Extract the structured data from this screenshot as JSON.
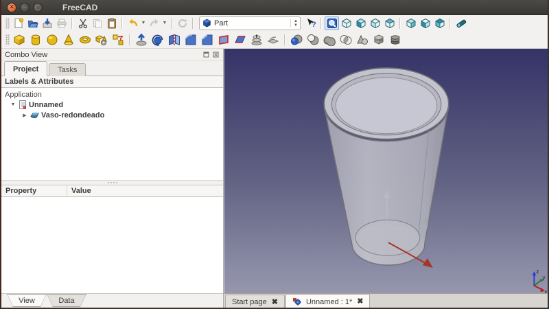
{
  "window": {
    "title": "FreeCAD",
    "controls": [
      "close",
      "minimize",
      "maximize"
    ]
  },
  "toolbars": {
    "row1_icons": [
      "new-file",
      "open-file",
      "save-file",
      "print",
      "cut",
      "copy",
      "paste",
      "undo",
      "undo-dropdown",
      "redo",
      "redo-dropdown",
      "refresh",
      "workbench-selector",
      "whats-this",
      "fit-all",
      "draw-style-cube",
      "axonometric-view",
      "front-view",
      "top-view",
      "rear-view",
      "left-view",
      "right-view",
      "measure-distance"
    ],
    "row2_icons": [
      "box-primitive",
      "cylinder-primitive",
      "sphere-primitive",
      "cone-primitive",
      "torus-primitive",
      "create-primitives",
      "shape-builder",
      "extrude",
      "revolve",
      "mirror",
      "fillet",
      "chamfer",
      "ruled-surface",
      "loft",
      "sweep",
      "boolean-operation",
      "boolean-cut",
      "boolean-union",
      "boolean-intersection",
      "section",
      "cross-sections",
      "compound"
    ],
    "workbench_selector": {
      "value": "Part"
    }
  },
  "combo_view": {
    "title": "Combo View",
    "tabs": [
      {
        "label": "Project"
      },
      {
        "label": "Tasks"
      }
    ],
    "active_tab": "Project",
    "labels_header": "Labels & Attributes",
    "tree": {
      "root_label": "Application",
      "document_label": "Unnamed",
      "part_label": "Vaso-redondeado",
      "expander_open": "▼",
      "expander_closed": "▶"
    },
    "property_table": {
      "columns": [
        {
          "label": "Property"
        },
        {
          "label": "Value"
        }
      ],
      "rows": []
    },
    "bottom_tabs": [
      {
        "label": "View",
        "active": true
      },
      {
        "label": "Data",
        "active": false
      }
    ]
  },
  "mdi_tab_bar": {
    "tabs": [
      {
        "label": "Start page",
        "close_glyph": "✖",
        "active": false
      },
      {
        "label": "Unnamed : 1*",
        "close_glyph": "✖",
        "active": true
      }
    ]
  },
  "viewport": {
    "background_top": "#343367",
    "background_bottom": "#9697ae",
    "axis_indicator": {
      "x": "x",
      "y": "y",
      "z": "z"
    }
  },
  "spinner": {
    "up": "▲",
    "down": "▼"
  },
  "dropdown_glyph": "▼"
}
